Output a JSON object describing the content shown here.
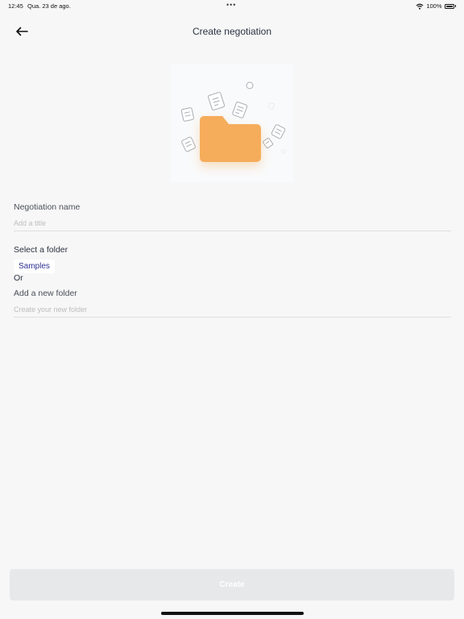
{
  "status_bar": {
    "time": "12:45",
    "date": "Qua. 23 de ago.",
    "dots": "•••",
    "battery": "100%"
  },
  "header": {
    "title": "Create negotiation"
  },
  "form": {
    "name_label": "Negotiation name",
    "name_placeholder": "Add a title",
    "folder_label": "Select a folder",
    "selected_folder": "Samples",
    "or_label": "Or",
    "new_folder_label": "Add a new folder",
    "new_folder_placeholder": "Create your new folder"
  },
  "footer": {
    "create_label": "Create"
  },
  "colors": {
    "background": "#f7f7f7",
    "folder": "#f5ad5c",
    "accent_text": "#2c3192",
    "button_disabled": "#e7e8ea"
  }
}
